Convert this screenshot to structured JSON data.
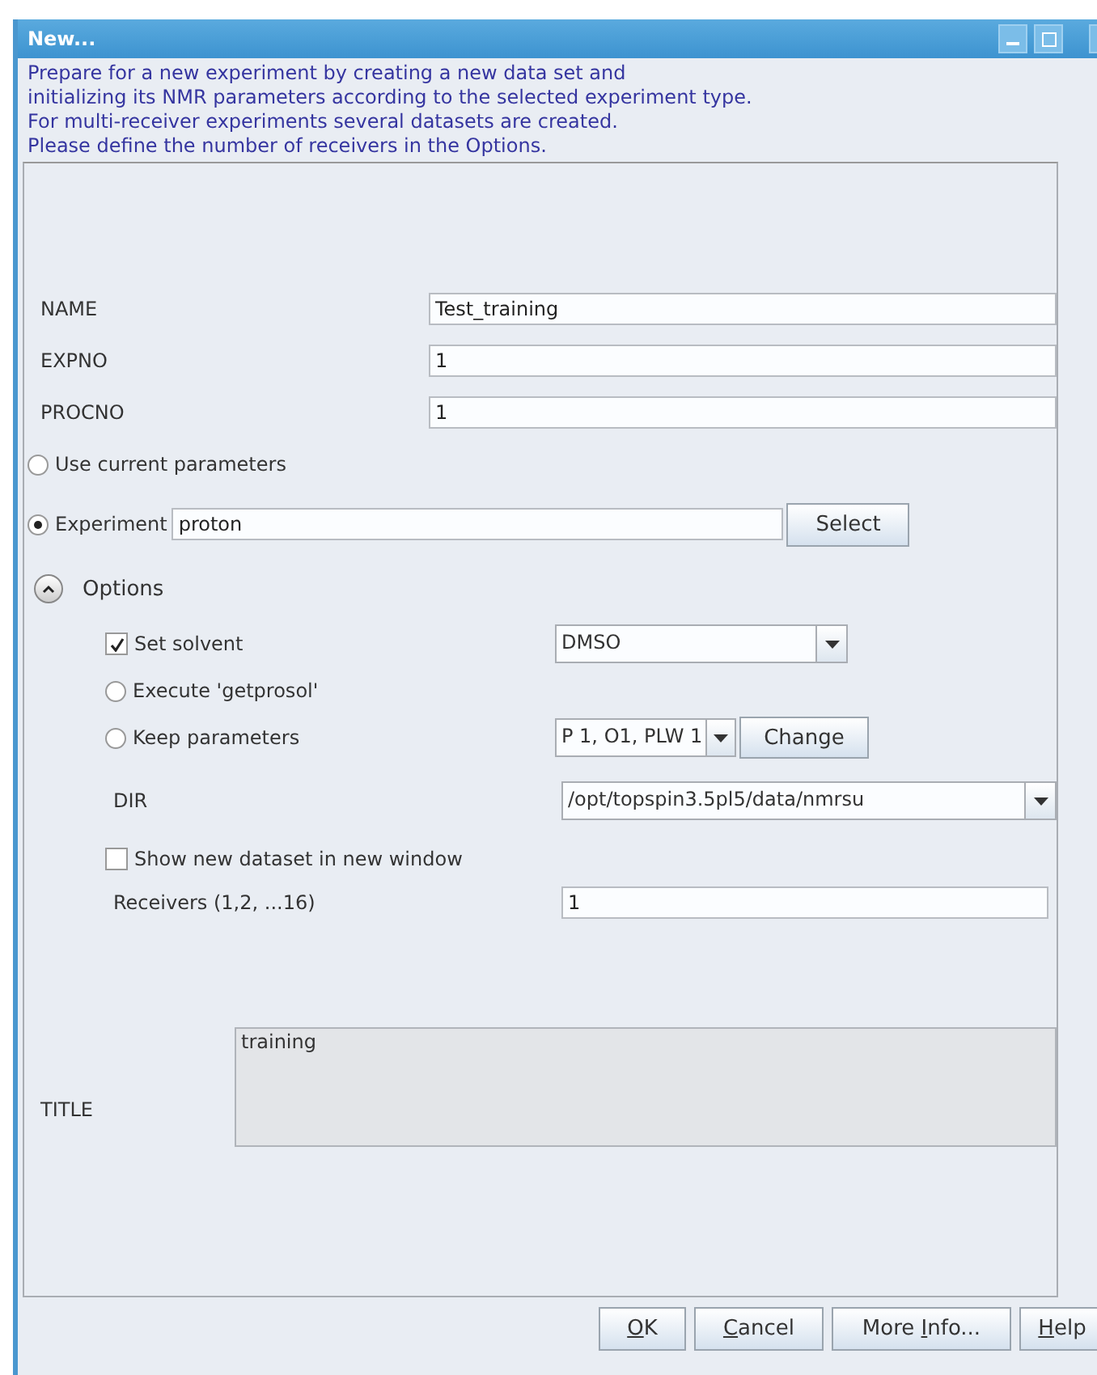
{
  "window": {
    "title": "New..."
  },
  "intro": [
    "Prepare for a new experiment by creating a new data set and",
    "initializing its NMR parameters according to the selected experiment type.",
    "For multi-receiver experiments several datasets are created.",
    "Please define the number of receivers in the Options."
  ],
  "fields": [
    {
      "label": "NAME",
      "value": "Test_training"
    },
    {
      "label": "EXPNO",
      "value": "1"
    },
    {
      "label": "PROCNO",
      "value": "1"
    }
  ],
  "source": [
    {
      "kind": "plain",
      "label": "Use current parameters",
      "selected": false
    },
    {
      "kind": "experiment",
      "label": "Experiment",
      "value": "proton",
      "button": "Select",
      "selected": true
    }
  ],
  "options": {
    "label": "Options",
    "expanded": true,
    "solvent": {
      "label": "Set solvent",
      "checked": true,
      "value": "DMSO"
    },
    "prosol": {
      "label": "Execute 'getprosol'",
      "selected": false
    },
    "keep": {
      "label": "Keep parameters",
      "selected": false,
      "value": "P 1, O1, PLW 1",
      "button": "Change"
    },
    "dir": {
      "label": "DIR",
      "value": "/opt/topspin3.5pl5/data/nmrsu"
    },
    "new_window": {
      "label": "Show new dataset in new window",
      "checked": false
    },
    "receivers": {
      "label": "Receivers (1,2, ...16)",
      "value": "1"
    }
  },
  "title_field": {
    "label": "TITLE",
    "value": "training"
  },
  "buttons": [
    {
      "mnemonic": "O",
      "rest": "K"
    },
    {
      "mnemonic": "C",
      "rest": "ancel"
    },
    {
      "before": "More ",
      "mnemonic": "I",
      "rest": "nfo..."
    },
    {
      "mnemonic": "H",
      "rest": "elp"
    }
  ]
}
